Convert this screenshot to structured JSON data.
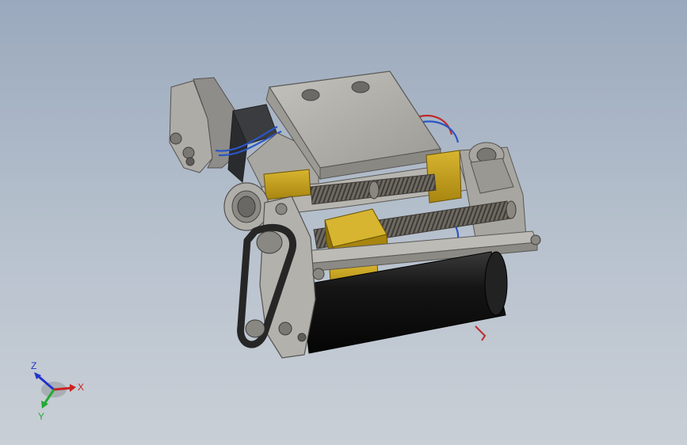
{
  "viewport": {
    "background_top": "#9aa9bd",
    "background_bottom": "#c9cfd6"
  },
  "model": {
    "colors": {
      "housing": "#b4b2ad",
      "housing_dark": "#8e8c88",
      "brass": "#c9a21a",
      "brass_dark": "#9a7a10",
      "motor": "#1b1b1b",
      "belt": "#2a2a2a",
      "screw": "#6e6a62",
      "wire_red": "#c0282a",
      "wire_blue": "#2a56c6"
    }
  },
  "triad": {
    "axes": [
      {
        "label": "Z",
        "color": "#2233cc",
        "icon": "z-axis-arrow"
      },
      {
        "label": "X",
        "color": "#cc2222",
        "icon": "x-axis-arrow"
      },
      {
        "label": "Y",
        "color": "#22aa33",
        "icon": "y-axis-arrow"
      }
    ]
  }
}
